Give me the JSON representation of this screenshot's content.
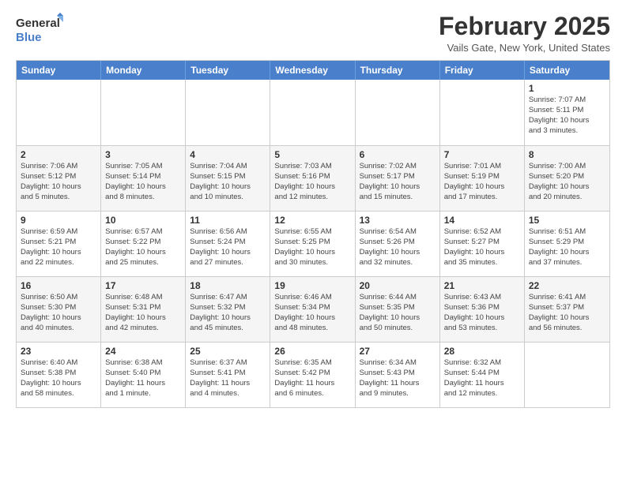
{
  "header": {
    "logo_line1": "General",
    "logo_line2": "Blue",
    "title": "February 2025",
    "subtitle": "Vails Gate, New York, United States"
  },
  "days_of_week": [
    "Sunday",
    "Monday",
    "Tuesday",
    "Wednesday",
    "Thursday",
    "Friday",
    "Saturday"
  ],
  "weeks": [
    [
      {
        "day": "",
        "info": ""
      },
      {
        "day": "",
        "info": ""
      },
      {
        "day": "",
        "info": ""
      },
      {
        "day": "",
        "info": ""
      },
      {
        "day": "",
        "info": ""
      },
      {
        "day": "",
        "info": ""
      },
      {
        "day": "1",
        "info": "Sunrise: 7:07 AM\nSunset: 5:11 PM\nDaylight: 10 hours\nand 3 minutes."
      }
    ],
    [
      {
        "day": "2",
        "info": "Sunrise: 7:06 AM\nSunset: 5:12 PM\nDaylight: 10 hours\nand 5 minutes."
      },
      {
        "day": "3",
        "info": "Sunrise: 7:05 AM\nSunset: 5:14 PM\nDaylight: 10 hours\nand 8 minutes."
      },
      {
        "day": "4",
        "info": "Sunrise: 7:04 AM\nSunset: 5:15 PM\nDaylight: 10 hours\nand 10 minutes."
      },
      {
        "day": "5",
        "info": "Sunrise: 7:03 AM\nSunset: 5:16 PM\nDaylight: 10 hours\nand 12 minutes."
      },
      {
        "day": "6",
        "info": "Sunrise: 7:02 AM\nSunset: 5:17 PM\nDaylight: 10 hours\nand 15 minutes."
      },
      {
        "day": "7",
        "info": "Sunrise: 7:01 AM\nSunset: 5:19 PM\nDaylight: 10 hours\nand 17 minutes."
      },
      {
        "day": "8",
        "info": "Sunrise: 7:00 AM\nSunset: 5:20 PM\nDaylight: 10 hours\nand 20 minutes."
      }
    ],
    [
      {
        "day": "9",
        "info": "Sunrise: 6:59 AM\nSunset: 5:21 PM\nDaylight: 10 hours\nand 22 minutes."
      },
      {
        "day": "10",
        "info": "Sunrise: 6:57 AM\nSunset: 5:22 PM\nDaylight: 10 hours\nand 25 minutes."
      },
      {
        "day": "11",
        "info": "Sunrise: 6:56 AM\nSunset: 5:24 PM\nDaylight: 10 hours\nand 27 minutes."
      },
      {
        "day": "12",
        "info": "Sunrise: 6:55 AM\nSunset: 5:25 PM\nDaylight: 10 hours\nand 30 minutes."
      },
      {
        "day": "13",
        "info": "Sunrise: 6:54 AM\nSunset: 5:26 PM\nDaylight: 10 hours\nand 32 minutes."
      },
      {
        "day": "14",
        "info": "Sunrise: 6:52 AM\nSunset: 5:27 PM\nDaylight: 10 hours\nand 35 minutes."
      },
      {
        "day": "15",
        "info": "Sunrise: 6:51 AM\nSunset: 5:29 PM\nDaylight: 10 hours\nand 37 minutes."
      }
    ],
    [
      {
        "day": "16",
        "info": "Sunrise: 6:50 AM\nSunset: 5:30 PM\nDaylight: 10 hours\nand 40 minutes."
      },
      {
        "day": "17",
        "info": "Sunrise: 6:48 AM\nSunset: 5:31 PM\nDaylight: 10 hours\nand 42 minutes."
      },
      {
        "day": "18",
        "info": "Sunrise: 6:47 AM\nSunset: 5:32 PM\nDaylight: 10 hours\nand 45 minutes."
      },
      {
        "day": "19",
        "info": "Sunrise: 6:46 AM\nSunset: 5:34 PM\nDaylight: 10 hours\nand 48 minutes."
      },
      {
        "day": "20",
        "info": "Sunrise: 6:44 AM\nSunset: 5:35 PM\nDaylight: 10 hours\nand 50 minutes."
      },
      {
        "day": "21",
        "info": "Sunrise: 6:43 AM\nSunset: 5:36 PM\nDaylight: 10 hours\nand 53 minutes."
      },
      {
        "day": "22",
        "info": "Sunrise: 6:41 AM\nSunset: 5:37 PM\nDaylight: 10 hours\nand 56 minutes."
      }
    ],
    [
      {
        "day": "23",
        "info": "Sunrise: 6:40 AM\nSunset: 5:38 PM\nDaylight: 10 hours\nand 58 minutes."
      },
      {
        "day": "24",
        "info": "Sunrise: 6:38 AM\nSunset: 5:40 PM\nDaylight: 11 hours\nand 1 minute."
      },
      {
        "day": "25",
        "info": "Sunrise: 6:37 AM\nSunset: 5:41 PM\nDaylight: 11 hours\nand 4 minutes."
      },
      {
        "day": "26",
        "info": "Sunrise: 6:35 AM\nSunset: 5:42 PM\nDaylight: 11 hours\nand 6 minutes."
      },
      {
        "day": "27",
        "info": "Sunrise: 6:34 AM\nSunset: 5:43 PM\nDaylight: 11 hours\nand 9 minutes."
      },
      {
        "day": "28",
        "info": "Sunrise: 6:32 AM\nSunset: 5:44 PM\nDaylight: 11 hours\nand 12 minutes."
      },
      {
        "day": "",
        "info": ""
      }
    ]
  ]
}
